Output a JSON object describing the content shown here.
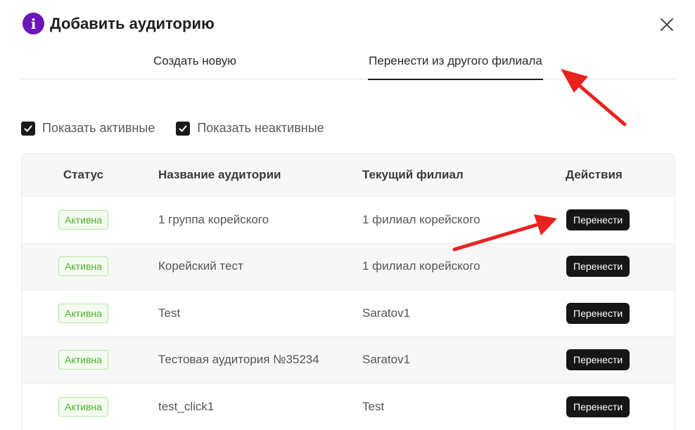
{
  "dialog": {
    "title": "Добавить аудиторию",
    "info_icon": "i"
  },
  "tabs": [
    {
      "label": "Создать новую",
      "active": false
    },
    {
      "label": "Перенести из другого филиала",
      "active": true
    }
  ],
  "filters": [
    {
      "label": "Показать активные",
      "checked": true
    },
    {
      "label": "Показать неактивные",
      "checked": true
    }
  ],
  "table": {
    "headers": {
      "status": "Статус",
      "name": "Название аудитории",
      "branch": "Текущий филиал",
      "actions": "Действия"
    },
    "rows": [
      {
        "status": "Активна",
        "name": "1 группа корейского",
        "branch": "1 филиал корейского",
        "action": "Перенести"
      },
      {
        "status": "Активна",
        "name": "Корейский тест",
        "branch": "1 филиал корейского",
        "action": "Перенести"
      },
      {
        "status": "Активна",
        "name": "Test",
        "branch": "Saratov1",
        "action": "Перенести"
      },
      {
        "status": "Активна",
        "name": "Тестовая аудитория №35234",
        "branch": "Saratov1",
        "action": "Перенести"
      },
      {
        "status": "Активна",
        "name": "test_click1",
        "branch": "Test",
        "action": "Перенести"
      }
    ]
  },
  "colors": {
    "accent_purple": "#6b14b8",
    "badge_green": "#4caf2c",
    "button_dark": "#161616",
    "annotation_arrow": "#e8231f"
  }
}
